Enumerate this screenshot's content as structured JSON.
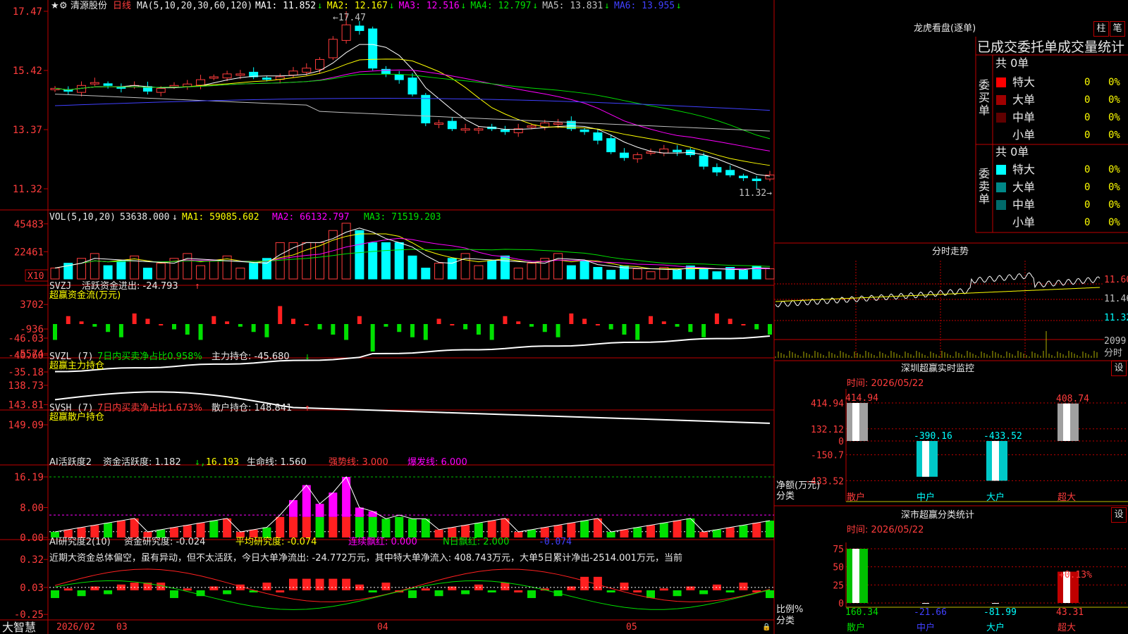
{
  "stock": {
    "name": "清源股份",
    "period": "日线"
  },
  "kline": {
    "ma_title": "MA(5,10,20,30,60,120)",
    "mas": [
      {
        "label": "MA1: 11.852",
        "arrow": "↓",
        "color": "#ffffff"
      },
      {
        "label": "MA2: 12.167",
        "arrow": "↓",
        "color": "#ffff00"
      },
      {
        "label": "MA3: 12.516",
        "arrow": "↓",
        "color": "#ff00ff"
      },
      {
        "label": "MA4: 12.797",
        "arrow": "↓",
        "color": "#00e000"
      },
      {
        "label": "MA5: 13.831",
        "arrow": "↓",
        "color": "#c0c0c0"
      },
      {
        "label": "MA6: 13.955",
        "arrow": "↓",
        "color": "#4040ff"
      }
    ],
    "yticks": [
      "17.47",
      "15.42",
      "13.37",
      "11.32"
    ],
    "high_label": "←17.47",
    "low_label": "11.32→",
    "closes": [
      14.8,
      14.7,
      14.9,
      15.0,
      14.9,
      14.8,
      14.9,
      14.7,
      14.8,
      14.9,
      14.95,
      15.1,
      15.2,
      15.3,
      15.3,
      15.2,
      15.15,
      15.2,
      15.4,
      15.5,
      15.8,
      16.5,
      17.0,
      16.8,
      15.5,
      15.3,
      15.1,
      14.6,
      13.6,
      13.6,
      13.4,
      13.4,
      13.4,
      13.4,
      13.3,
      13.4,
      13.5,
      13.6,
      13.6,
      13.4,
      13.3,
      13.0,
      12.6,
      12.4,
      12.5,
      12.6,
      12.7,
      12.6,
      12.5,
      12.1,
      11.9,
      11.8,
      11.7,
      11.6,
      11.8
    ]
  },
  "vol": {
    "title": "VOL(5,10,20)",
    "v": "53638.000",
    "ma1": "MA1: 59085.602",
    "ma2": "MA2: 66132.797",
    "ma3": "MA3: 71519.203",
    "arrow": "↓",
    "yticks": [
      "45483",
      "22461"
    ],
    "unit": "X10"
  },
  "svzj": {
    "title": "SVZJ",
    "label": "活跃资金进出: -24.793",
    "arrow": "↑",
    "sub": "超赢资金流(万元)",
    "yticks": [
      "3702",
      "-936",
      "-5574"
    ]
  },
  "svzl": {
    "title": "SVZL (7)",
    "ratio": "7日内买卖净占比0.958%",
    "label": "主力持仓: -45.680",
    "arrow": "↓",
    "sub": "超赢主力持仓",
    "yticks": [
      "-35.18",
      "-40.60",
      "-46.03"
    ]
  },
  "svsh": {
    "title": "SVSH (7)",
    "ratio": "7日内买卖净占比1.673%",
    "label": "散户持仓: 148.841",
    "arrow": "↑",
    "sub": "超赢散户持仓",
    "yticks": [
      "149.09",
      "143.81",
      "138.73"
    ]
  },
  "ai1": {
    "title": "AI活跃度2",
    "l1": "资金活跃度: 1.182",
    "v2": "16.193",
    "l3": "生命线: 1.560",
    "l4": "强势线: 3.000",
    "l5": "爆发线: 6.000",
    "yticks": [
      "16.19",
      "8.00",
      "0.00"
    ]
  },
  "ai2": {
    "title": "AI研究度2(10)",
    "l1": "资金研究度: -0.024",
    "l2": "平均研究度: -0.074",
    "l3": "连续飘红: 0.000",
    "l4": "N日飘红: 2.000",
    "l5": "-0.074",
    "yticks": [
      "0.32",
      "0.03",
      "-0.25"
    ],
    "comment": "近期大资金总体偏空，虽有异动，但不太活跃，今日大单净流出: -24.772万元，其中特大单净流入: 408.743万元，大单5日累计净出-2514.001万元，当前"
  },
  "xaxis": {
    "logo": "大智慧",
    "labels": [
      "2026/02",
      "03",
      "04",
      "05"
    ]
  },
  "longhu": {
    "title": "龙虎看盘(逐单)",
    "btn1": "柱",
    "btn2": "笔",
    "heading": "已成交委托单成交量统计",
    "buy": {
      "side": "委买单",
      "total": "共 0单",
      "rows": [
        {
          "name": "特大",
          "count": "0",
          "pct": "0%",
          "color": "#ff0000"
        },
        {
          "name": "大单",
          "count": "0",
          "pct": "0%",
          "color": "#a00000"
        },
        {
          "name": "中单",
          "count": "0",
          "pct": "0%",
          "color": "#600000"
        },
        {
          "name": "小单",
          "count": "0",
          "pct": "0%",
          "color": ""
        }
      ]
    },
    "sell": {
      "side": "委卖单",
      "total": "共 0单",
      "rows": [
        {
          "name": "特大",
          "count": "0",
          "pct": "0%",
          "color": "#00ffff"
        },
        {
          "name": "大单",
          "count": "0",
          "pct": "0%",
          "color": "#008888"
        },
        {
          "name": "中单",
          "count": "0",
          "pct": "0%",
          "color": "#006a6a"
        },
        {
          "name": "小单",
          "count": "0",
          "pct": "0%",
          "color": ""
        }
      ]
    }
  },
  "fenshi": {
    "title": "分时走势",
    "yticks": [
      "11.60",
      "11.46",
      "11.32"
    ],
    "vol": "2099",
    "vol_label": "分时"
  },
  "monitor": {
    "title": "深圳超赢实时监控",
    "btn": "设",
    "time": "时间: 2026/05/22",
    "yticks": [
      "414.94",
      "132.12",
      "0",
      "-150.7",
      "-433.52"
    ],
    "ylabel1": "净额(万元)",
    "ylabel2": "分类",
    "bars": [
      {
        "cat": "散户",
        "value": 414.94,
        "label": "414.94"
      },
      {
        "cat": "中户",
        "value": -390.16,
        "label": "-390.16"
      },
      {
        "cat": "大户",
        "value": -433.52,
        "label": "-433.52"
      },
      {
        "cat": "超大",
        "value": 408.74,
        "label": "408.74"
      }
    ]
  },
  "stats": {
    "title": "深市超赢分类统计",
    "btn": "设",
    "time": "时间: 2026/05/22",
    "yticks": [
      "75",
      "50",
      "25",
      "0"
    ],
    "ylabel1": "比例%",
    "ylabel2": "分类",
    "topnote": "+0.13%",
    "bars": [
      {
        "cat": "散户",
        "value": 160.34,
        "label": "160.34"
      },
      {
        "cat": "中户",
        "value": -21.66,
        "label": "-21.66"
      },
      {
        "cat": "大户",
        "value": -81.99,
        "label": "-81.99"
      },
      {
        "cat": "超大",
        "value": 43.31,
        "label": "43.31"
      }
    ]
  }
}
